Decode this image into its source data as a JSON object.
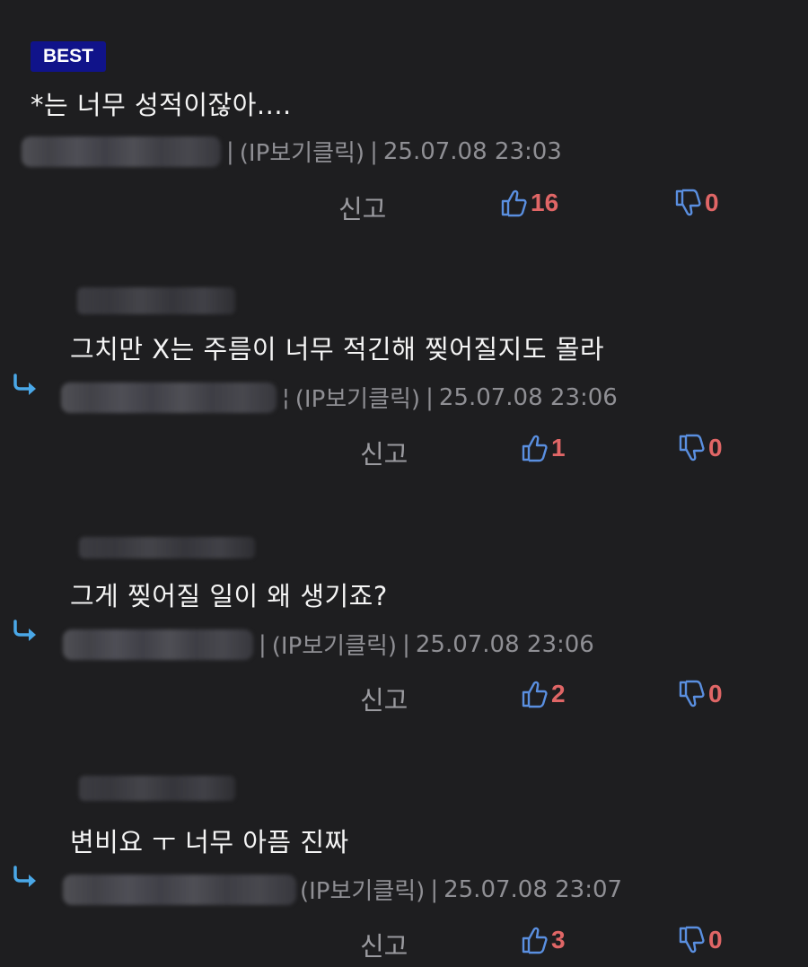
{
  "comments": [
    {
      "badge": "BEST",
      "text": "*는 너무 성적이잖아....",
      "ip_label": "(IP보기클릭)",
      "timestamp": "25.07.08 23:03",
      "report_label": "신고",
      "likes": "16",
      "dislikes": "0"
    },
    {
      "text": "그치만 X는 주름이 너무 적긴해 찢어질지도 몰라",
      "ip_label": "(IP보기클릭)",
      "timestamp": "25.07.08 23:06",
      "report_label": "신고",
      "likes": "1",
      "dislikes": "0"
    },
    {
      "text": "그게 찢어질 일이 왜 생기죠?",
      "ip_label": "(IP보기클릭)",
      "timestamp": "25.07.08 23:06",
      "report_label": "신고",
      "likes": "2",
      "dislikes": "0"
    },
    {
      "text": "변비요 ㅜ 너무 아픔 진짜",
      "ip_label": "(IP보기클릭)",
      "timestamp": "25.07.08 23:07",
      "report_label": "신고",
      "likes": "3",
      "dislikes": "0"
    }
  ],
  "colors": {
    "background": "#1e1e20",
    "badge": "#10138a",
    "icon_blue": "#5a8fe0",
    "count_red": "#e06666",
    "reply_arrow": "#4aa8e8",
    "meta_gray": "#8f8f94"
  },
  "icons": {
    "like": "thumbs-up-icon",
    "dislike": "thumbs-down-icon",
    "reply": "reply-arrow-icon"
  }
}
